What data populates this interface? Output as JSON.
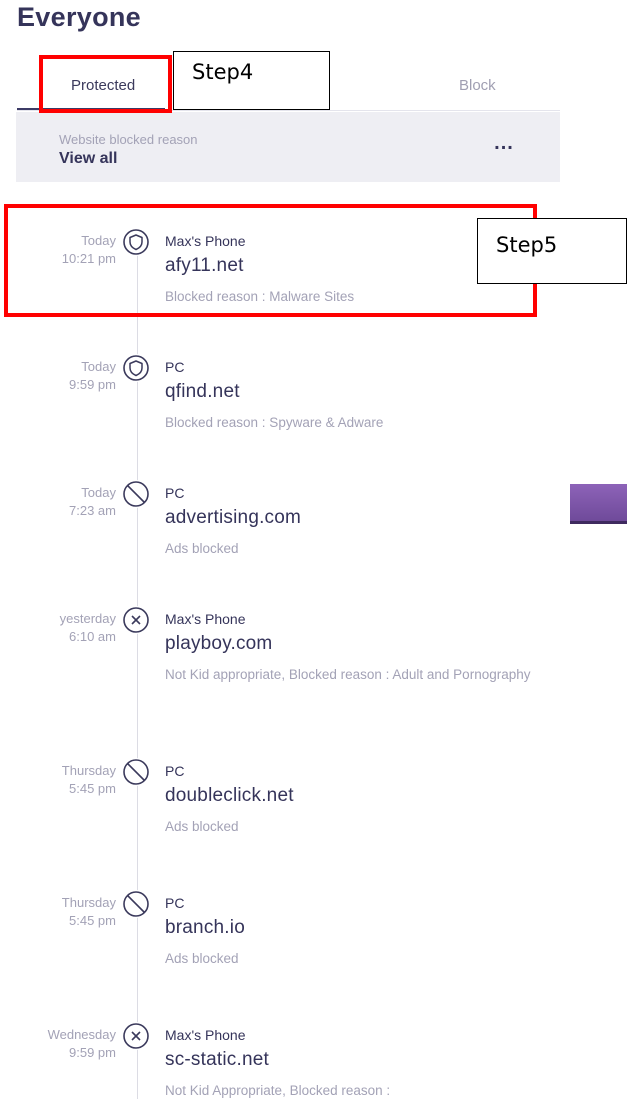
{
  "page": {
    "title": "Everyone"
  },
  "tabs": {
    "protected": "Protected",
    "block": "Block"
  },
  "filter": {
    "caption": "Website blocked reason",
    "value": "View all",
    "more": "..."
  },
  "entries": [
    {
      "day": "Today",
      "time": "10:21 pm",
      "icon": "shield-icon",
      "device": "Max's Phone",
      "domain": "afy11.net",
      "reason": "Blocked reason : Malware Sites"
    },
    {
      "day": "Today",
      "time": "9:59 pm",
      "icon": "shield-icon",
      "device": "PC",
      "domain": "qfind.net",
      "reason": "Blocked reason : Spyware & Adware"
    },
    {
      "day": "Today",
      "time": "7:23 am",
      "icon": "ban-icon",
      "device": "PC",
      "domain": "advertising.com",
      "reason": "Ads blocked"
    },
    {
      "day": "yesterday",
      "time": "6:10 am",
      "icon": "x-circle-icon",
      "device": "Max's Phone",
      "domain": "playboy.com",
      "reason": "Not Kid appropriate, Blocked reason : Adult and Pornography"
    },
    {
      "day": "Thursday",
      "time": "5:45 pm",
      "icon": "ban-icon",
      "device": "PC",
      "domain": "doubleclick.net",
      "reason": "Ads blocked"
    },
    {
      "day": "Thursday",
      "time": "5:45 pm",
      "icon": "ban-icon",
      "device": "PC",
      "domain": "branch.io",
      "reason": "Ads blocked"
    },
    {
      "day": "Wednesday",
      "time": "9:59 pm",
      "icon": "x-circle-icon",
      "device": "Max's Phone",
      "domain": "sc-static.net",
      "reason": "Not Kid Appropriate, Blocked reason :"
    }
  ],
  "annotations": {
    "step4": "Step4",
    "step5": "Step5",
    "highlight_color": "#ff0000"
  }
}
